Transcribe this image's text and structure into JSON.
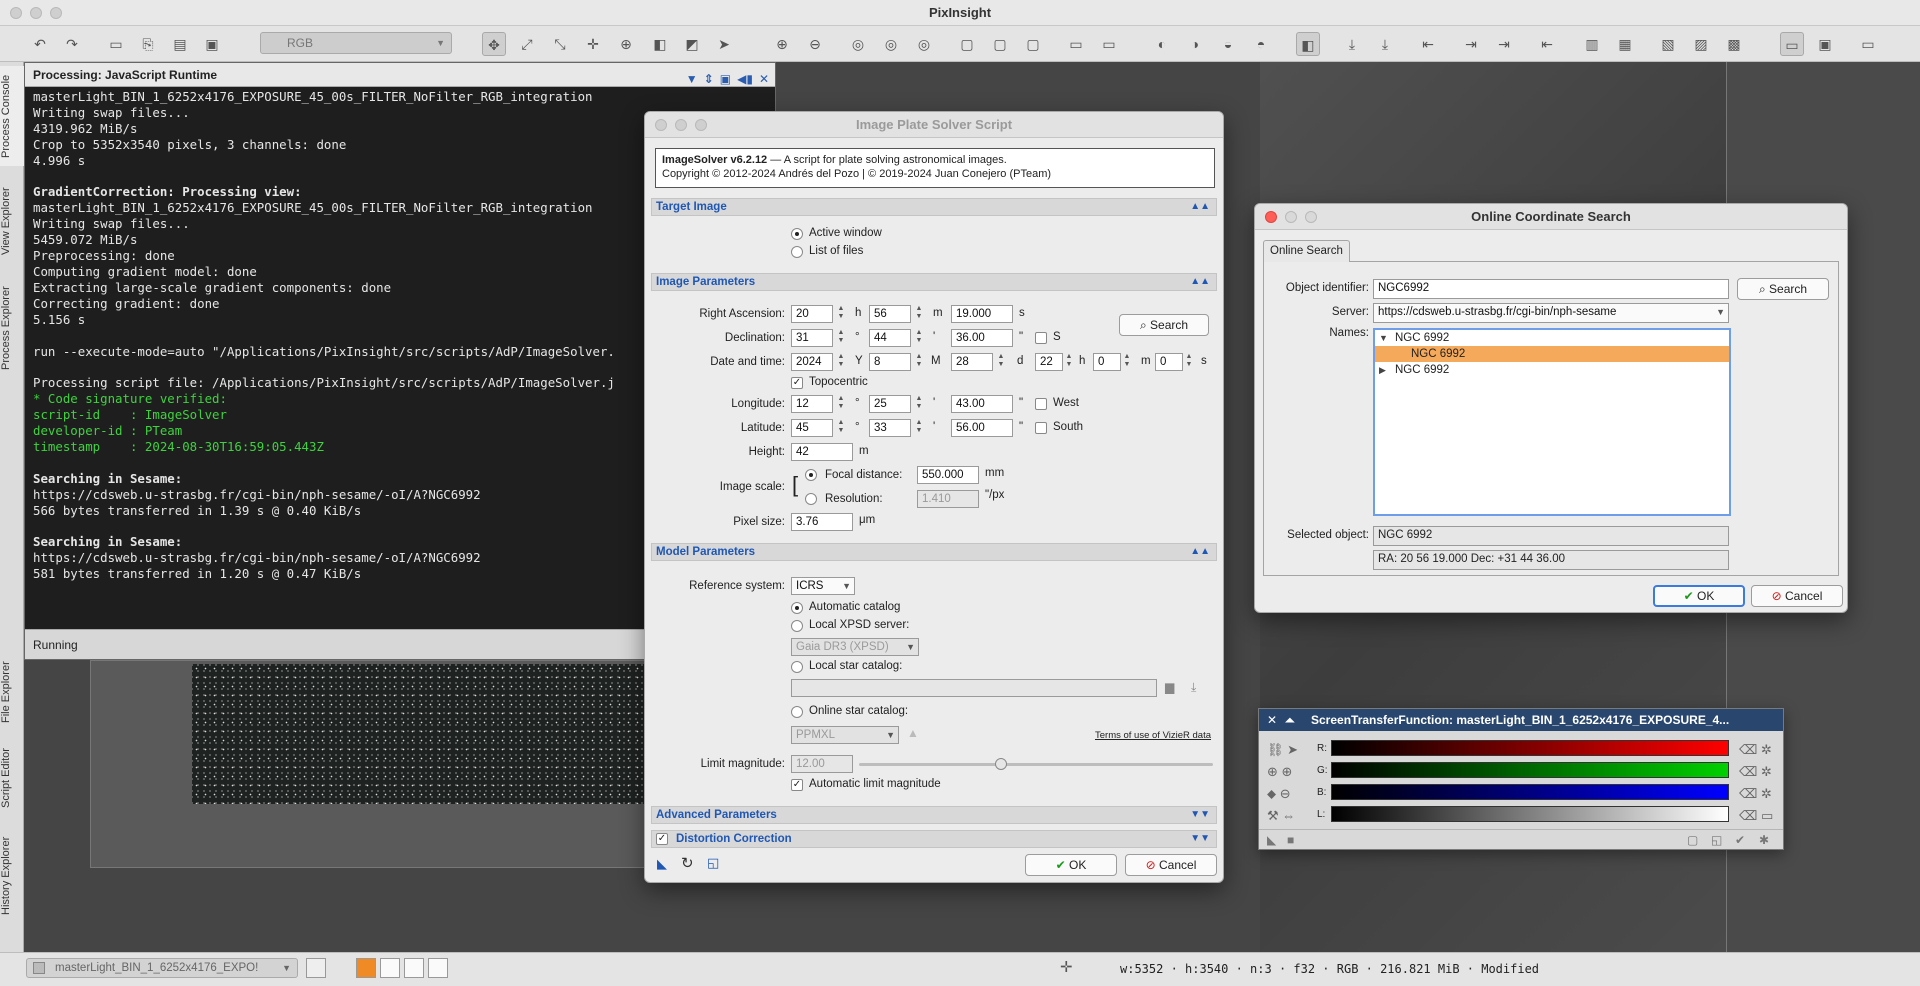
{
  "app": {
    "title": "PixInsight"
  },
  "toolbar": {
    "rgb_select": "RGB"
  },
  "sidebar": {
    "tabs": [
      "Process Console",
      "View Explorer",
      "Process Explorer",
      "File Explorer",
      "Script Editor",
      "History Explorer"
    ]
  },
  "console": {
    "title": "Processing: JavaScript Runtime",
    "lines": [
      {
        "t": "masterLight_BIN_1_6252x4176_EXPOSURE_45_00s_FILTER_NoFilter_RGB_integration",
        "c": ""
      },
      {
        "t": "Writing swap files...",
        "c": ""
      },
      {
        "t": "4319.962 MiB/s",
        "c": ""
      },
      {
        "t": "Crop to 5352x3540 pixels, 3 channels: done",
        "c": ""
      },
      {
        "t": "4.996 s",
        "c": ""
      },
      {
        "t": "",
        "c": ""
      },
      {
        "t": "GradientCorrection: Processing view:",
        "c": "b"
      },
      {
        "t": "masterLight_BIN_1_6252x4176_EXPOSURE_45_00s_FILTER_NoFilter_RGB_integration",
        "c": ""
      },
      {
        "t": "Writing swap files...",
        "c": ""
      },
      {
        "t": "5459.072 MiB/s",
        "c": ""
      },
      {
        "t": "Preprocessing: done",
        "c": ""
      },
      {
        "t": "Computing gradient model: done",
        "c": ""
      },
      {
        "t": "Extracting large-scale gradient components: done",
        "c": ""
      },
      {
        "t": "Correcting gradient: done",
        "c": ""
      },
      {
        "t": "5.156 s",
        "c": ""
      },
      {
        "t": "",
        "c": ""
      },
      {
        "t": "run --execute-mode=auto \"/Applications/PixInsight/src/scripts/AdP/ImageSolver.",
        "c": ""
      },
      {
        "t": "",
        "c": ""
      },
      {
        "t": "Processing script file: /Applications/PixInsight/src/scripts/AdP/ImageSolver.j",
        "c": ""
      },
      {
        "t": "* Code signature verified:",
        "c": "g"
      },
      {
        "t": "script-id    : ImageSolver",
        "c": "g"
      },
      {
        "t": "developer-id : PTeam",
        "c": "g"
      },
      {
        "t": "timestamp    : 2024-08-30T16:59:05.443Z",
        "c": "g"
      },
      {
        "t": "",
        "c": ""
      },
      {
        "t": "Searching in Sesame:",
        "c": "b"
      },
      {
        "t": "https://cdsweb.u-strasbg.fr/cgi-bin/nph-sesame/-oI/A?NGC6992",
        "c": ""
      },
      {
        "t": "566 bytes transferred in 1.39 s @ 0.40 KiB/s",
        "c": ""
      },
      {
        "t": "",
        "c": ""
      },
      {
        "t": "Searching in Sesame:",
        "c": "b"
      },
      {
        "t": "https://cdsweb.u-strasbg.fr/cgi-bin/nph-sesame/-oI/A?NGC6992",
        "c": ""
      },
      {
        "t": "581 bytes transferred in 1.20 s @ 0.47 KiB/s",
        "c": ""
      }
    ],
    "status": "Running"
  },
  "solver": {
    "title": "Image Plate Solver Script",
    "header_title": "ImageSolver v6.2.12",
    "header_desc": " — A script for plate solving astronomical images.",
    "header_copy": "Copyright © 2012-2024 Andrés del Pozo | © 2019-2024 Juan Conejero (PTeam)",
    "target_section": "Target Image",
    "active_window": "Active window",
    "list_files": "List of files",
    "params_section": "Image Parameters",
    "ra_label": "Right Ascension:",
    "ra": [
      "20",
      "56",
      "19.000"
    ],
    "ra_units": [
      "h",
      "m",
      "s"
    ],
    "dec_label": "Declination:",
    "dec": [
      "31",
      "44",
      "36.00"
    ],
    "dms_units": [
      "°",
      "'",
      "\""
    ],
    "south_s": "S",
    "date_label": "Date and time:",
    "date": [
      "2024",
      "8",
      "28",
      "22",
      "0",
      "0"
    ],
    "date_units": [
      "Y",
      "M",
      "d",
      "h",
      "m",
      "s"
    ],
    "search_btn": "Search",
    "topocentric": "Topocentric",
    "lon_label": "Longitude:",
    "lon": [
      "12",
      "25",
      "43.00"
    ],
    "west": "West",
    "lat_label": "Latitude:",
    "lat": [
      "45",
      "33",
      "56.00"
    ],
    "south": "South",
    "height_label": "Height:",
    "height": "42",
    "height_unit": "m",
    "scale_label": "Image scale:",
    "focal_label": "Focal distance:",
    "focal": "550.000",
    "focal_unit": "mm",
    "res_label": "Resolution:",
    "res": "1.410",
    "res_unit": "\"/px",
    "pixel_label": "Pixel size:",
    "pixel": "3.76",
    "pixel_unit": "μm",
    "model_section": "Model Parameters",
    "ref_label": "Reference system:",
    "ref": "ICRS",
    "auto_catalog": "Automatic catalog",
    "local_xpsd": "Local XPSD server:",
    "xpsd_value": "Gaia DR3 (XPSD)",
    "local_star": "Local star catalog:",
    "online_star": "Online star catalog:",
    "online_value": "PPMXL",
    "terms": "Terms of use of VizieR data",
    "limit_label": "Limit magnitude:",
    "limit": "12.00",
    "limit_fraction": 0.4,
    "auto_limit": "Automatic limit magnitude",
    "advanced_section": "Advanced Parameters",
    "distortion_section": "Distortion Correction",
    "ok": "OK",
    "cancel": "Cancel"
  },
  "coord": {
    "title": "Online Coordinate Search",
    "tab": "Online Search",
    "object_label": "Object identifier:",
    "object": "NGC6992",
    "search": "Search",
    "server_label": "Server:",
    "server": "https://cdsweb.u-strasbg.fr/cgi-bin/nph-sesame",
    "names_label": "Names:",
    "names": [
      {
        "label": "NGC 6992",
        "level": 0,
        "toggle": "▼",
        "selected": false
      },
      {
        "label": "NGC 6992",
        "level": 1,
        "toggle": "",
        "selected": true
      },
      {
        "label": "NGC 6992",
        "level": 0,
        "toggle": "▶",
        "selected": false
      }
    ],
    "selected_label": "Selected object:",
    "selected": "NGC 6992",
    "radec": "RA: 20 56 19.000  Dec: +31 44 36.00",
    "ok": "OK",
    "cancel": "Cancel"
  },
  "stf": {
    "title": "ScreenTransferFunction: masterLight_BIN_1_6252x4176_EXPOSURE_4...",
    "channels": [
      "R:",
      "G:",
      "B:",
      "L:"
    ],
    "colors": {
      "r": "#ff0000",
      "g": "#00d000",
      "b": "#0000ff",
      "l": "#ffffff"
    }
  },
  "status": {
    "view": "masterLight_BIN_1_6252x4176_EXPO!",
    "info": "w:5352 · h:3540 · n:3 · f32 · RGB · 216.821 MiB · Modified"
  }
}
